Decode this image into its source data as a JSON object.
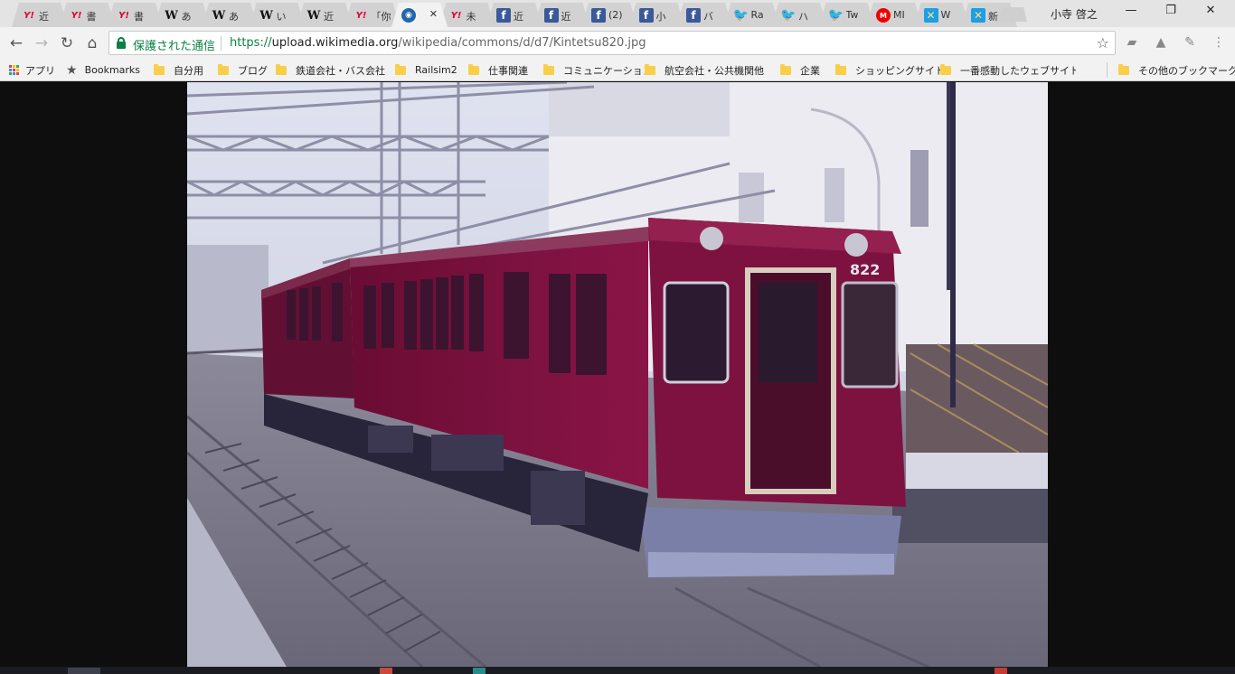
{
  "browser": {
    "tabs": [
      {
        "icon": "yahoo-icon",
        "glyph": "Y!",
        "title": "近",
        "active": false
      },
      {
        "icon": "yahoo-icon",
        "glyph": "Y!",
        "title": "書",
        "active": false
      },
      {
        "icon": "yahoo-icon",
        "glyph": "Y!",
        "title": "書",
        "active": false
      },
      {
        "icon": "wikipedia-icon",
        "glyph": "W",
        "title": "あ",
        "active": false
      },
      {
        "icon": "wikipedia-icon",
        "glyph": "W",
        "title": "あ",
        "active": false
      },
      {
        "icon": "wikipedia-icon",
        "glyph": "W",
        "title": "い",
        "active": false
      },
      {
        "icon": "wikipedia-icon",
        "glyph": "W",
        "title": "近",
        "active": false
      },
      {
        "icon": "yahoo-icon",
        "glyph": "Y!",
        "title": "「你",
        "active": false
      },
      {
        "icon": "wikimedia-icon",
        "glyph": "◉",
        "title": "",
        "active": true
      },
      {
        "icon": "yahoo-icon",
        "glyph": "Y!",
        "title": "未",
        "active": false
      },
      {
        "icon": "facebook-icon",
        "glyph": "f",
        "title": "近",
        "active": false
      },
      {
        "icon": "facebook-icon",
        "glyph": "f",
        "title": "近",
        "active": false
      },
      {
        "icon": "facebook-icon",
        "glyph": "f",
        "title": "(2)",
        "active": false
      },
      {
        "icon": "facebook-icon",
        "glyph": "f",
        "title": "小",
        "active": false
      },
      {
        "icon": "facebook-icon",
        "glyph": "f",
        "title": "バ",
        "active": false
      },
      {
        "icon": "twitter-icon",
        "glyph": "🐦",
        "title": "Ra",
        "active": false
      },
      {
        "icon": "twitter-icon",
        "glyph": "🐦",
        "title": "ハ",
        "active": false
      },
      {
        "icon": "twitter-icon",
        "glyph": "🐦",
        "title": "Tw",
        "active": false
      },
      {
        "icon": "ml-icon",
        "glyph": "M",
        "title": "MI",
        "active": false
      },
      {
        "icon": "star-app-icon",
        "glyph": "✕",
        "title": "W",
        "active": false
      },
      {
        "icon": "star-app-icon",
        "glyph": "✕",
        "title": "新",
        "active": false
      }
    ],
    "user_name": "小寺 啓之",
    "window_controls": {
      "minimize": "—",
      "restore": "❐",
      "close": "✕"
    }
  },
  "toolbar": {
    "back": "←",
    "forward": "→",
    "reload": "↻",
    "home": "⌂",
    "secure_label": "保護された通信",
    "url_scheme": "https://",
    "url_host": "upload.wikimedia.org",
    "url_path": "/wikipedia/commons/d/d7/Kintetsu820.jpg",
    "bookmark_star": "☆",
    "extensions": [
      "▰",
      "▲",
      "✎",
      "⋮"
    ]
  },
  "bookmarks": [
    {
      "type": "apps",
      "label": "アプリ"
    },
    {
      "type": "star",
      "label": "Bookmarks"
    },
    {
      "type": "folder",
      "label": "自分用"
    },
    {
      "type": "folder",
      "label": "ブログ"
    },
    {
      "type": "folder",
      "label": "鉄道会社・バス会社"
    },
    {
      "type": "folder",
      "label": "Railsim2"
    },
    {
      "type": "folder",
      "label": "仕事関連"
    },
    {
      "type": "folder",
      "label": "コミュニケーション"
    },
    {
      "type": "folder",
      "label": "航空会社・公共機関他"
    },
    {
      "type": "folder",
      "label": "企業"
    },
    {
      "type": "folder",
      "label": "ショッピングサイト"
    },
    {
      "type": "folder",
      "label": "一番感動したウェブサイト"
    },
    {
      "type": "folder",
      "label": "その他のブックマーク"
    }
  ],
  "photo": {
    "car_number": "822",
    "colors": {
      "train_body": "#7a0f3a",
      "train_shadow": "#4e0828",
      "sky": "#dde0ee",
      "building": "#e8e6ee"
    }
  }
}
